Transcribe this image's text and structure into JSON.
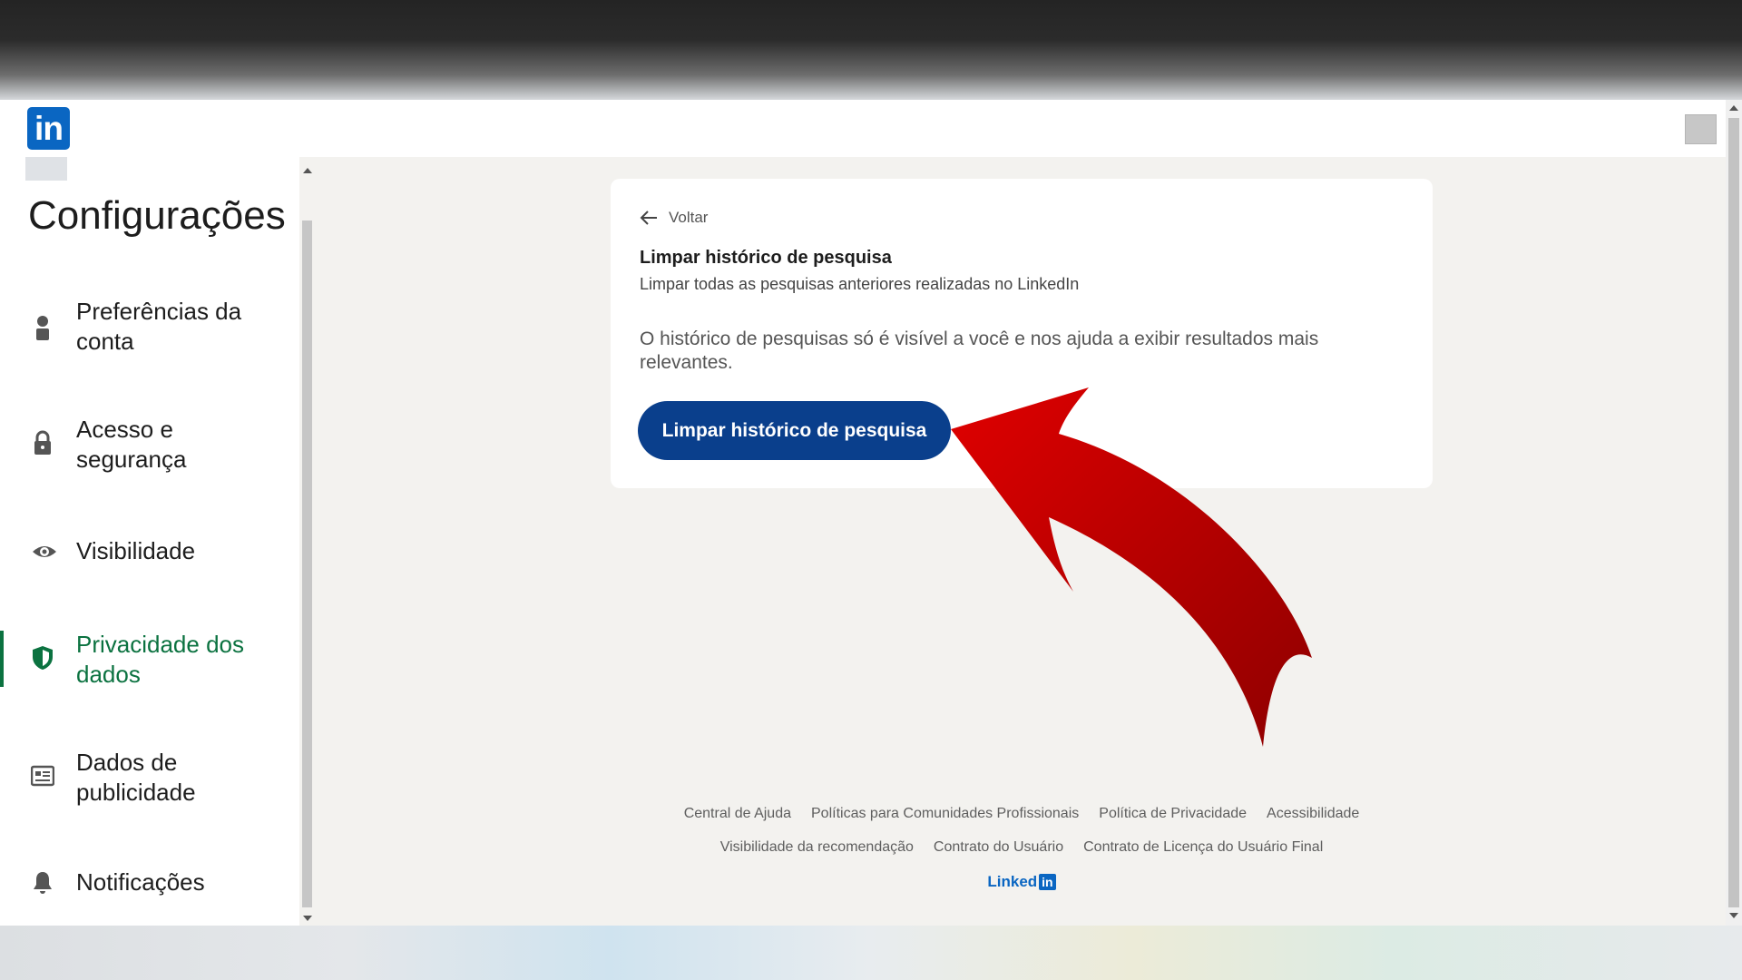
{
  "header": {
    "logo_text": "in"
  },
  "sidebar": {
    "title": "Configurações",
    "items": [
      {
        "label": "Preferências da conta",
        "icon": "person-icon",
        "active": false
      },
      {
        "label": "Acesso e segurança",
        "icon": "lock-icon",
        "active": false
      },
      {
        "label": "Visibilidade",
        "icon": "eye-icon",
        "active": false
      },
      {
        "label": "Privacidade dos dados",
        "icon": "shield-icon",
        "active": true
      },
      {
        "label": "Dados de publicidade",
        "icon": "newspaper-icon",
        "active": false
      },
      {
        "label": "Notificações",
        "icon": "bell-icon",
        "active": false
      }
    ]
  },
  "card": {
    "back_label": "Voltar",
    "title": "Limpar histórico de pesquisa",
    "subtitle": "Limpar todas as pesquisas anteriores realizadas no LinkedIn",
    "description": "O histórico de pesquisas só é visível a você e nos ajuda a exibir resultados mais relevantes.",
    "button_label": "Limpar histórico de pesquisa"
  },
  "footer": {
    "row1": [
      "Central de Ajuda",
      "Políticas para Comunidades Profissionais",
      "Política de Privacidade",
      "Acessibilidade"
    ],
    "row2": [
      "Visibilidade da recomendação",
      "Contrato do Usuário",
      "Contrato de Licença do Usuário Final"
    ],
    "brand_text": "Linked",
    "brand_box": "in"
  },
  "colors": {
    "brand_blue": "#0a66c2",
    "button_blue": "#0a3f8c",
    "active_green": "#0b7240",
    "annotation_red": "#c40000"
  }
}
